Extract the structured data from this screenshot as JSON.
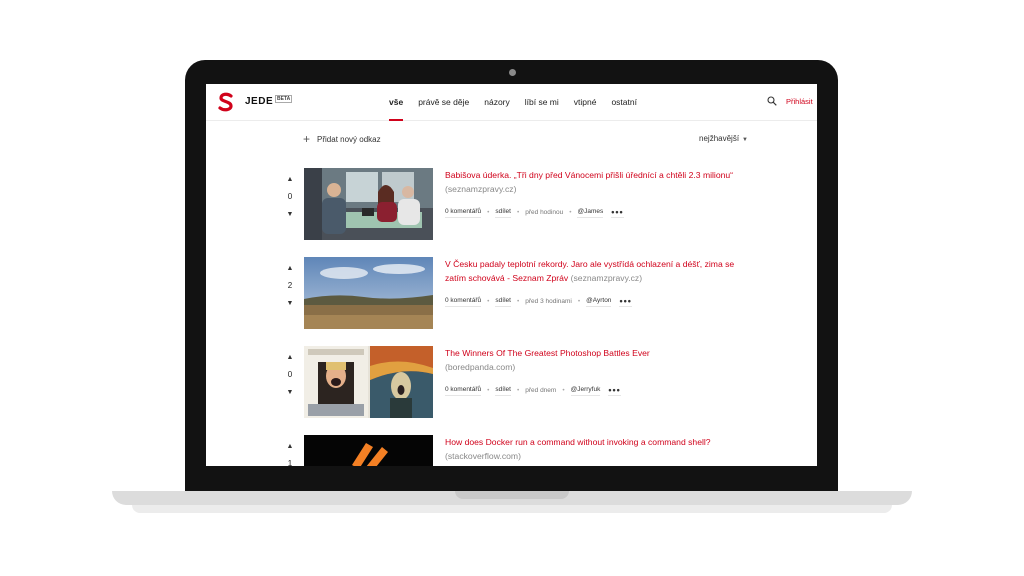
{
  "brand": {
    "name": "JEDE",
    "badge": "BETA",
    "accent": "#d0021b"
  },
  "nav": {
    "items": [
      {
        "label": "vše",
        "active": true
      },
      {
        "label": "právě se děje"
      },
      {
        "label": "názory"
      },
      {
        "label": "líbí se mi"
      },
      {
        "label": "vtipné"
      },
      {
        "label": "ostatní"
      }
    ],
    "login": "Přihlásit"
  },
  "toolbar": {
    "add_label": "Přidat nový odkaz",
    "sort_label": "nejžhavější"
  },
  "posts": [
    {
      "score": "0",
      "title": "Babišova úderka. „Tři dny před Vánocemi přišli úřednící a chtěli 2.3 milionu“",
      "domain": "(seznamzpravy.cz)",
      "comments": "0 komentářů",
      "share": "sdílet",
      "time": "před hodinou",
      "user": "@James"
    },
    {
      "score": "2",
      "title": "V Česku padaly teplotní rekordy. Jaro ale vystřídá ochlazení a déšť, zima se zatím schovává - Seznam Zpráv",
      "domain": "(seznamzpravy.cz)",
      "comments": "0 komentářů",
      "share": "sdílet",
      "time": "před 3 hodinami",
      "user": "@Ayrton"
    },
    {
      "score": "0",
      "title": "The Winners Of The Greatest Photoshop Battles Ever",
      "domain": "(boredpanda.com)",
      "comments": "0 komentářů",
      "share": "sdílet",
      "time": "před dnem",
      "user": "@Jerryfuk"
    },
    {
      "score": "1",
      "title": "How does Docker run a command without invoking a command shell?",
      "domain": "(stackoverflow.com)"
    }
  ],
  "icons": {
    "upvote": "upvote-arrow-icon",
    "downvote": "downvote-arrow-icon",
    "more": "more-dots-icon",
    "search": "search-icon"
  }
}
